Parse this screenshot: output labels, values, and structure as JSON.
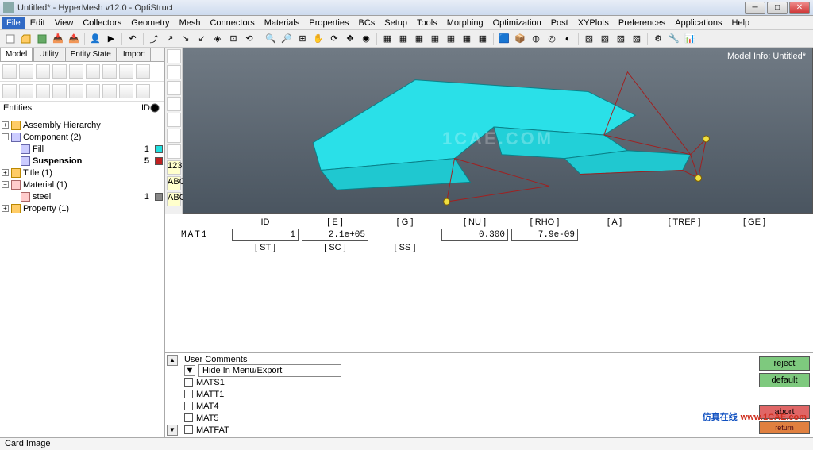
{
  "title": "Untitled* - HyperMesh v12.0 - OptiStruct",
  "menu": [
    "File",
    "Edit",
    "View",
    "Collectors",
    "Geometry",
    "Mesh",
    "Connectors",
    "Materials",
    "Properties",
    "BCs",
    "Setup",
    "Tools",
    "Morphing",
    "Optimization",
    "Post",
    "XYPlots",
    "Preferences",
    "Applications",
    "Help"
  ],
  "tabs": [
    "Model",
    "Utility",
    "Entity State",
    "Import"
  ],
  "tree_header": {
    "c1": "Entities",
    "c2": "ID"
  },
  "tree": {
    "assembly": "Assembly Hierarchy",
    "component": {
      "label": "Component (2)",
      "children": [
        {
          "name": "Fill",
          "id": "1",
          "color": "#20e0e0"
        },
        {
          "name": "Suspension",
          "id": "5",
          "color": "#c02020",
          "bold": true
        }
      ]
    },
    "title": {
      "label": "Title (1)"
    },
    "material": {
      "label": "Material (1)",
      "children": [
        {
          "name": "steel",
          "id": "1",
          "color": "#888"
        }
      ]
    },
    "property": {
      "label": "Property (1)"
    }
  },
  "model_info": "Model Info: Untitled*",
  "watermark": "1CAE.COM",
  "mat_label": "MAT1",
  "param_headers_r1": [
    "ID",
    "[ E ]",
    "[ G ]",
    "[ NU ]",
    "[ RHO ]",
    "[ A ]",
    "[ TREF ]",
    "[ GE ]"
  ],
  "param_values_r1": {
    "id": "1",
    "e": "2.1e+05",
    "nu": "0.300",
    "rho": "7.9e-09"
  },
  "param_headers_r2": [
    "[ ST ]",
    "[ SC ]",
    "[ SS ]"
  ],
  "comments_hdr": "User Comments",
  "hide_label": "Hide In Menu/Export",
  "mat_options": [
    "MATS1",
    "MATT1",
    "MAT4",
    "MAT5",
    "MATFAT"
  ],
  "buttons": {
    "reject": "reject",
    "default": "default",
    "abort": "abort",
    "return": "return"
  },
  "status": "Card Image",
  "brand_cn": "仿真在线",
  "brand_url": "www.1CAE.com"
}
